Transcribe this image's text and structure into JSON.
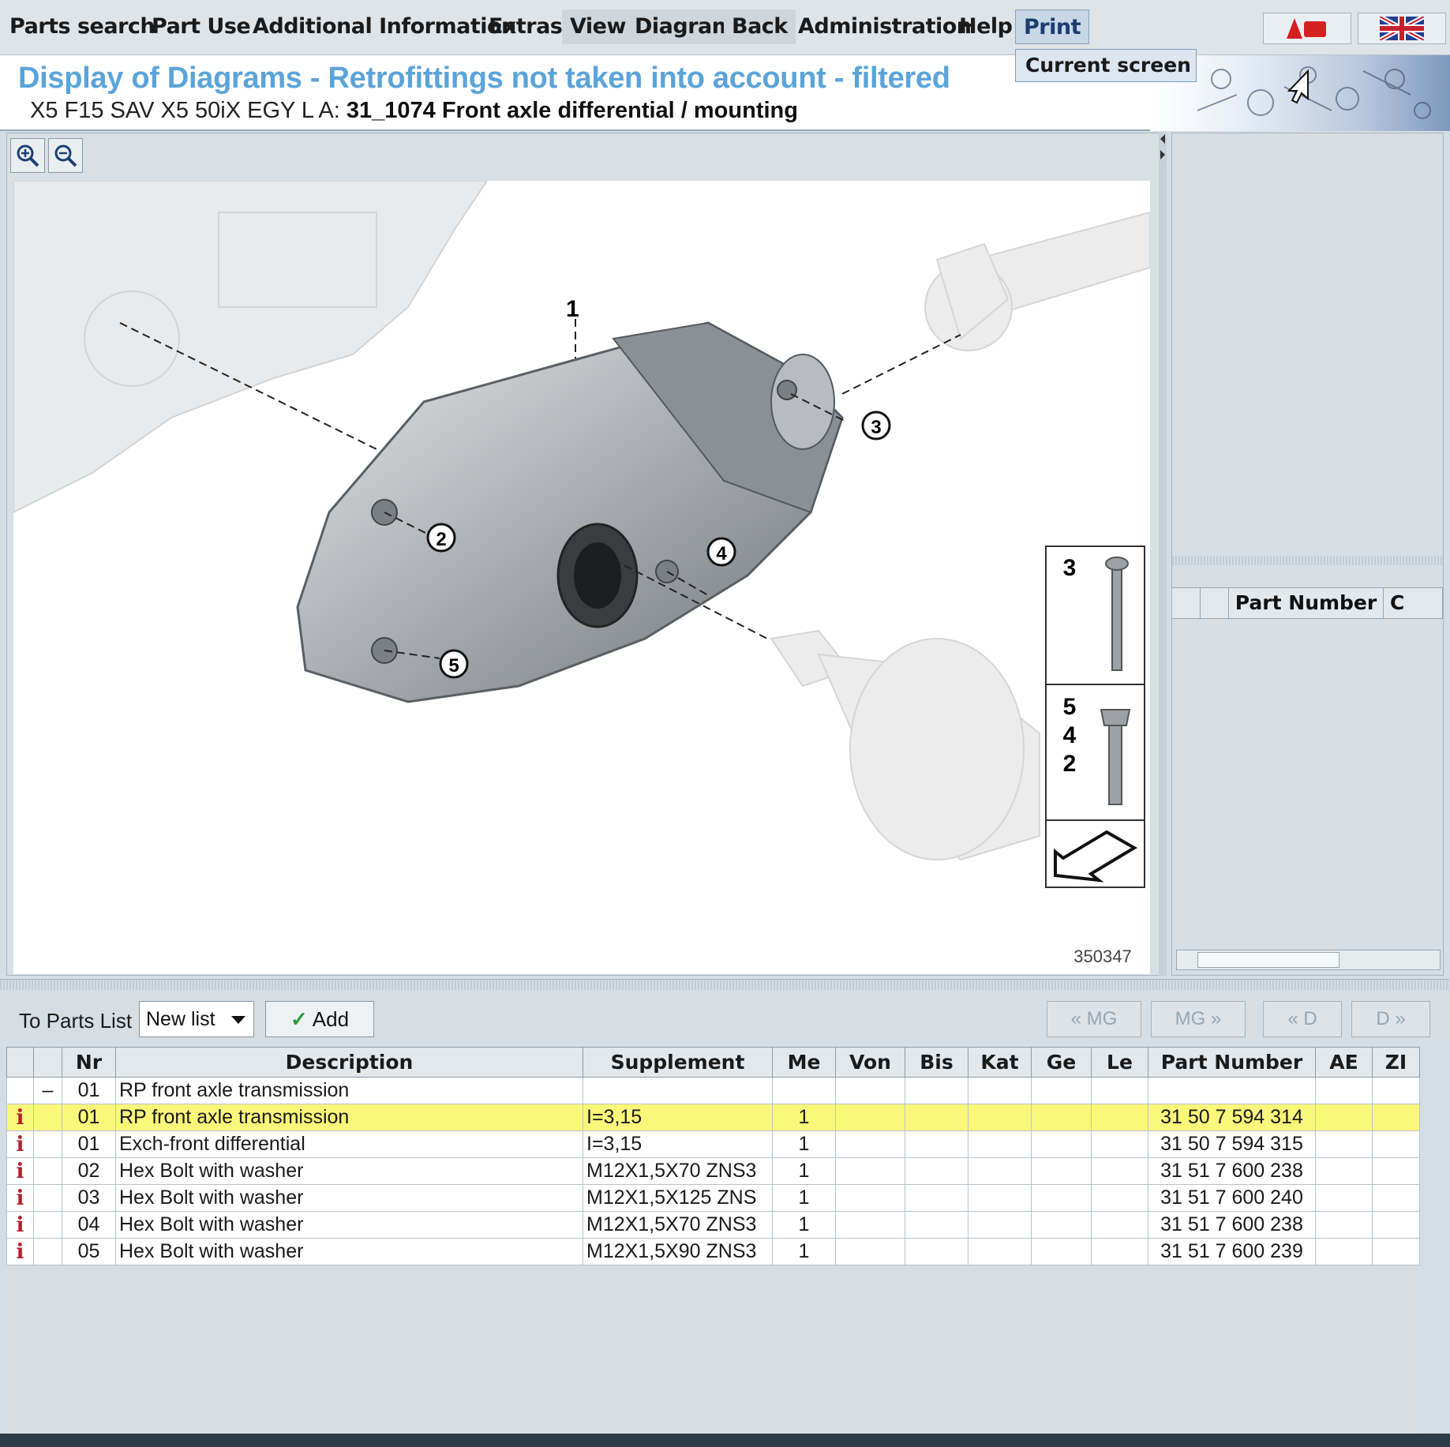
{
  "menu": {
    "items": [
      {
        "id": "parts-search",
        "label": "Parts search",
        "left": 0
      },
      {
        "id": "part-use",
        "label": "Part Use"
      },
      {
        "id": "additional-information",
        "label": "Additional Information"
      },
      {
        "id": "extras",
        "label": "Extras"
      },
      {
        "id": "view",
        "label": "View"
      },
      {
        "id": "diagram",
        "label": "Diagram"
      },
      {
        "id": "back",
        "label": "Back"
      },
      {
        "id": "administration",
        "label": "Administration"
      },
      {
        "id": "help",
        "label": "Help"
      },
      {
        "id": "print",
        "label": "Print"
      }
    ],
    "print_dropdown": "Current screen"
  },
  "header": {
    "title": "Display of Diagrams - Retrofittings not taken into account - filtered",
    "vehicle": "X5 F15 SAV X5 50iX EGY  L A:",
    "group": "31_1074 Front axle differential / mounting"
  },
  "diagram": {
    "callouts": [
      "1",
      "2",
      "3",
      "4",
      "5"
    ],
    "legend_top": "3",
    "legend_mid": [
      "5",
      "4",
      "2"
    ],
    "image_number": "350347"
  },
  "right_panel": {
    "header_part_number": "Part Number",
    "header_next": "C"
  },
  "toolbar": {
    "to_parts_list": "To Parts List",
    "list_select": "New list",
    "add": "Add",
    "prev_mg": "« MG",
    "next_mg": "MG »",
    "prev_d": "« D",
    "next_d": "D »"
  },
  "table": {
    "headers": [
      "",
      "",
      "Nr",
      "Description",
      "Supplement",
      "Me",
      "Von",
      "Bis",
      "Kat",
      "Ge",
      "Le",
      "Part Number",
      "AE",
      "ZI"
    ],
    "rows": [
      {
        "info": "",
        "tree": "–",
        "nr": "01",
        "desc": "RP front axle transmission",
        "supp": "",
        "me": "",
        "pn": "",
        "selected": false
      },
      {
        "info": "i",
        "tree": "",
        "nr": "01",
        "desc": "RP front axle transmission",
        "supp": "I=3,15",
        "me": "1",
        "pn": "31 50 7 594 314",
        "selected": true
      },
      {
        "info": "i",
        "tree": "",
        "nr": "01",
        "desc": "Exch-front differential",
        "supp": "I=3,15",
        "me": "1",
        "pn": "31 50 7 594 315",
        "selected": false
      },
      {
        "info": "i",
        "tree": "",
        "nr": "02",
        "desc": "Hex Bolt with washer",
        "supp": "M12X1,5X70 ZNS3",
        "me": "1",
        "pn": "31 51 7 600 238",
        "selected": false
      },
      {
        "info": "i",
        "tree": "",
        "nr": "03",
        "desc": "Hex Bolt with washer",
        "supp": "M12X1,5X125 ZNS",
        "me": "1",
        "pn": "31 51 7 600 240",
        "selected": false
      },
      {
        "info": "i",
        "tree": "",
        "nr": "04",
        "desc": "Hex Bolt with washer",
        "supp": "M12X1,5X70 ZNS3",
        "me": "1",
        "pn": "31 51 7 600 238",
        "selected": false
      },
      {
        "info": "i",
        "tree": "",
        "nr": "05",
        "desc": "Hex Bolt with washer",
        "supp": "M12X1,5X90 ZNS3",
        "me": "1",
        "pn": "31 51 7 600 239",
        "selected": false
      }
    ]
  },
  "colors": {
    "title": "#5ba4d9",
    "selected_row": "#fbf77a",
    "info_icon": "#b3202a"
  }
}
